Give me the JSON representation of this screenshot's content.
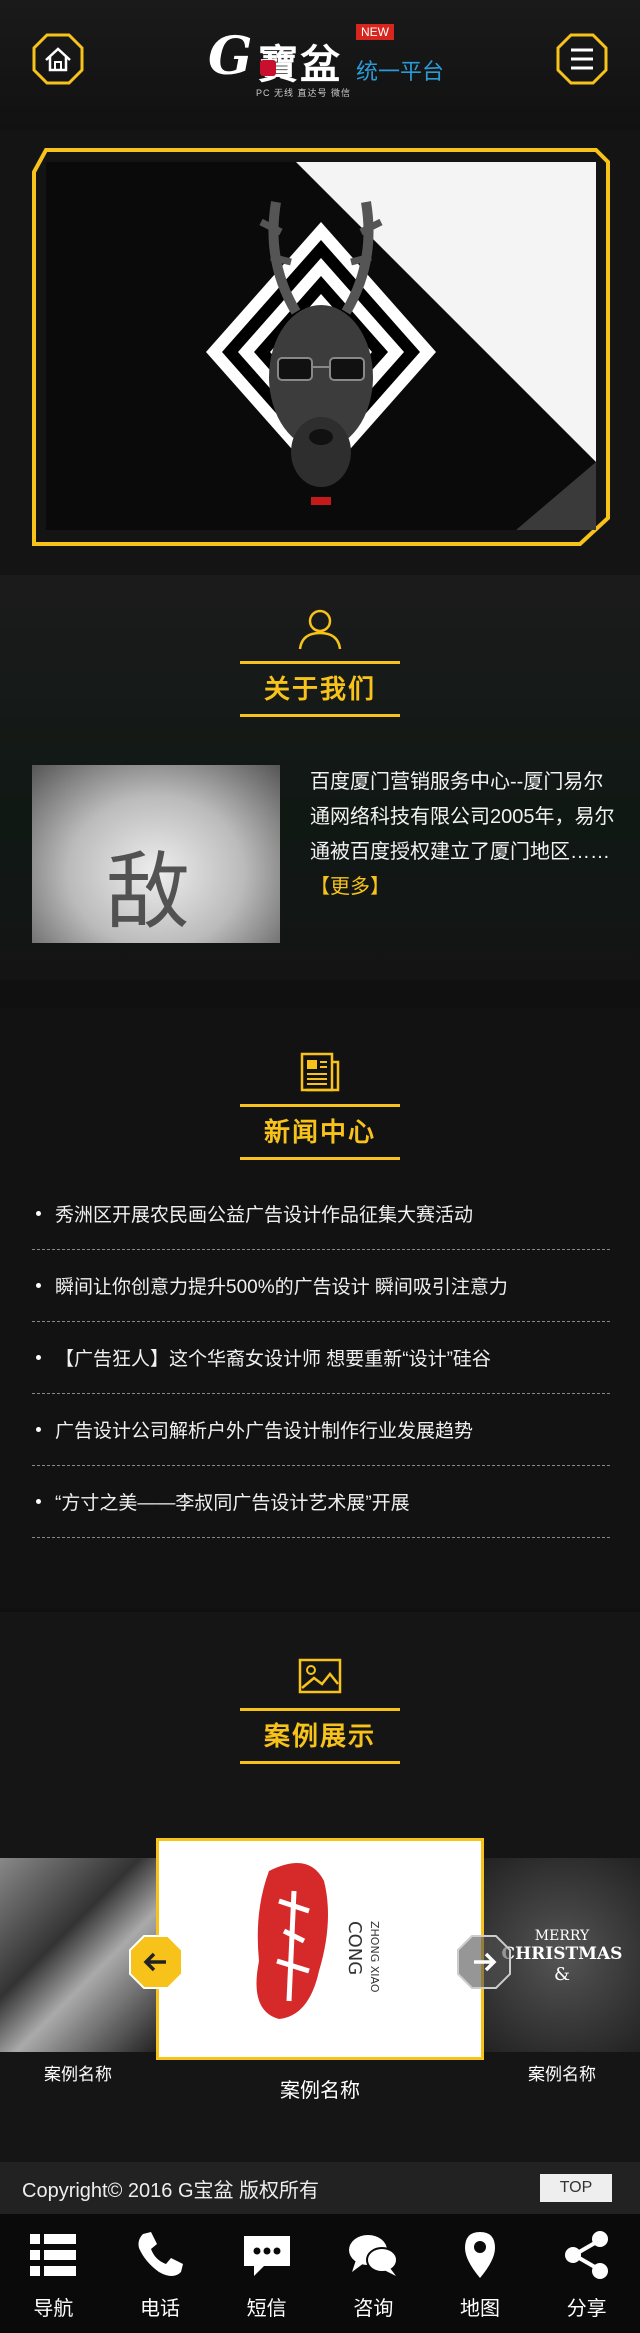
{
  "header": {
    "logo_g": "G",
    "logo_cn": "寶盆",
    "logo_new": "NEW",
    "logo_sub": "统一平台",
    "logo_tag": "PC 无线 直达号 微信"
  },
  "colors": {
    "accent": "#f7c21a",
    "brand_blue": "#2a9bd7",
    "badge_red": "#d7261e"
  },
  "about": {
    "title": "关于我们",
    "image_char": "敌",
    "text": "百度厦门营销服务中心--厦门易尔通网络科技有限公司2005年，易尔通被百度授权建立了厦门地区……",
    "more": "【更多】"
  },
  "news": {
    "title": "新闻中心",
    "items": [
      "秀洲区开展农民画公益广告设计作品征集大赛活动",
      "瞬间让你创意力提升500%的广告设计 瞬间吸引注意力",
      "【广告狂人】这个华裔女设计师 想要重新“设计”硅谷",
      "广告设计公司解析户外广告设计制作行业发展趋势",
      "“方寸之美——李叔同广告设计艺术展”开展"
    ]
  },
  "cases": {
    "title": "案例展示",
    "left_caption": "案例名称",
    "center_caption": "案例名称",
    "right_caption": "案例名称",
    "center_logo_latin": "CONG",
    "center_logo_sub": "ZHONG XIAO",
    "right_text_1": "MERRY",
    "right_text_2": "CHRISTMAS",
    "right_text_3": "&"
  },
  "footer": {
    "copyright": "Copyright© 2016  G宝盆 版权所有",
    "top": "TOP"
  },
  "bottom_nav": [
    {
      "label": "导航",
      "icon": "list-icon"
    },
    {
      "label": "电话",
      "icon": "phone-icon"
    },
    {
      "label": "短信",
      "icon": "sms-icon"
    },
    {
      "label": "咨询",
      "icon": "chat-icon"
    },
    {
      "label": "地图",
      "icon": "map-pin-icon"
    },
    {
      "label": "分享",
      "icon": "share-icon"
    }
  ]
}
